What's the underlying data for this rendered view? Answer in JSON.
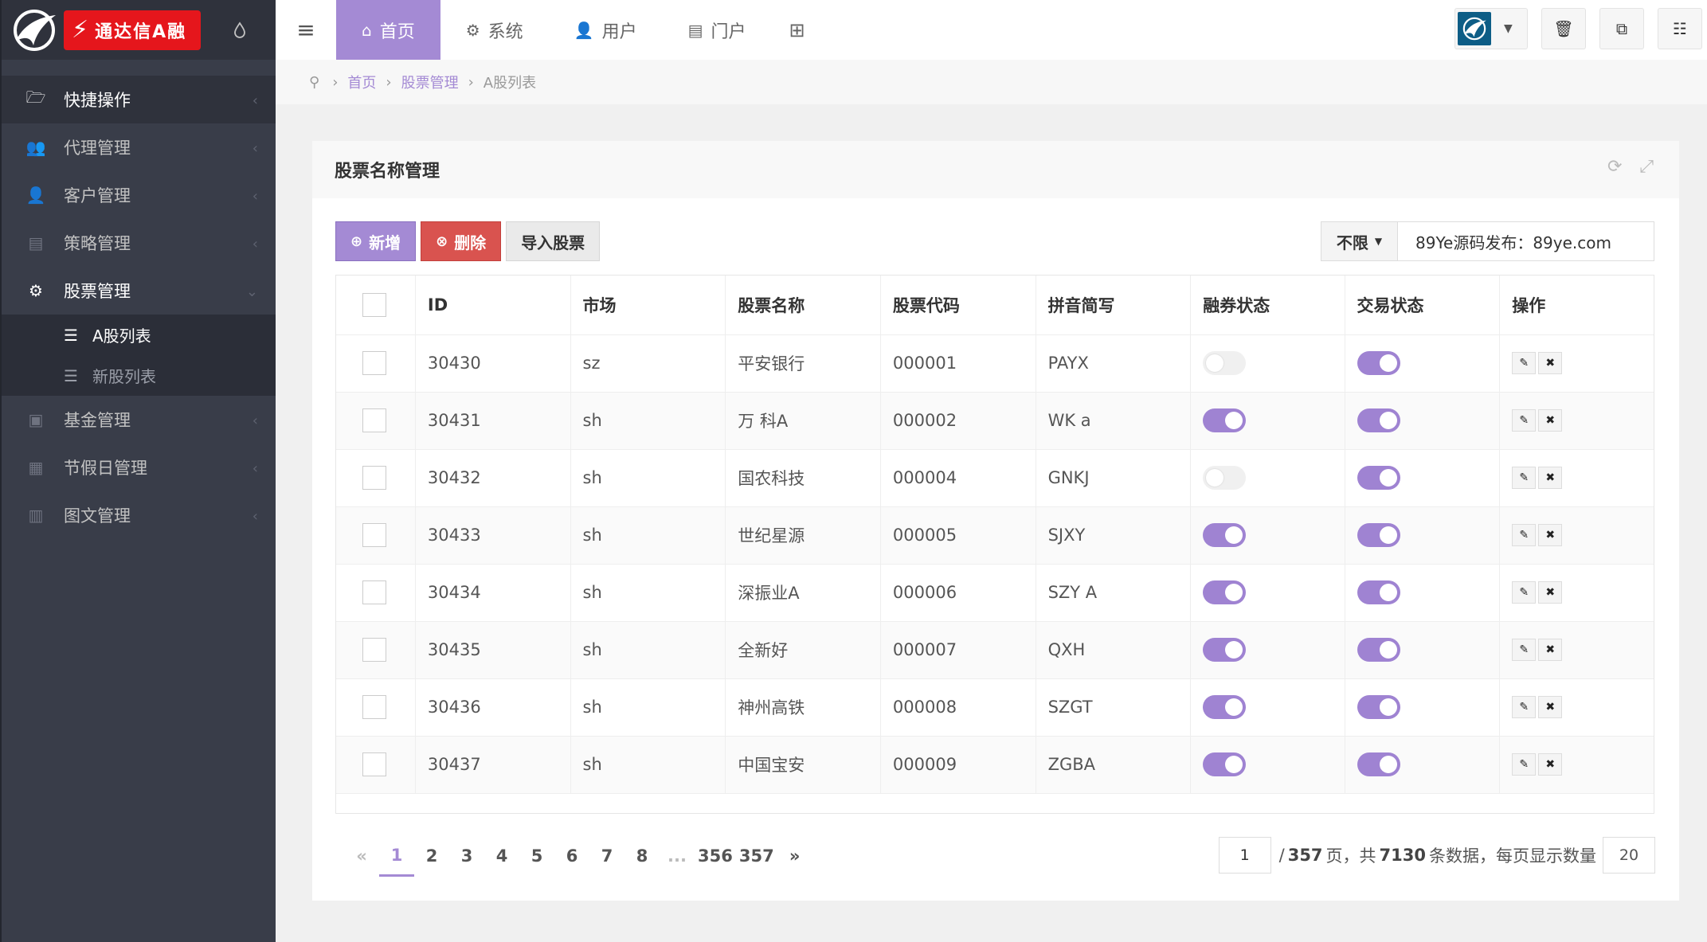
{
  "brand": {
    "logo_text": "通达信A融",
    "logo_mark": "⚡"
  },
  "sidebar": {
    "items": [
      {
        "label": "快捷操作",
        "icon": "folder-open-icon",
        "glyph": "🗁"
      },
      {
        "label": "代理管理",
        "icon": "users-icon",
        "glyph": "👥"
      },
      {
        "label": "客户管理",
        "icon": "user-icon",
        "glyph": "👤"
      },
      {
        "label": "策略管理",
        "icon": "list-alt-icon",
        "glyph": "▤"
      },
      {
        "label": "股票管理",
        "icon": "cogs-icon",
        "glyph": "⚙"
      },
      {
        "label": "基金管理",
        "icon": "money-icon",
        "glyph": "▣"
      },
      {
        "label": "节假日管理",
        "icon": "calendar-icon",
        "glyph": "▦"
      },
      {
        "label": "图文管理",
        "icon": "book-icon",
        "glyph": "▥"
      }
    ],
    "submenu": [
      {
        "label": "A股列表"
      },
      {
        "label": "新股列表"
      }
    ]
  },
  "topbar": {
    "tabs": [
      {
        "label": "首页",
        "glyph": "⌂"
      },
      {
        "label": "系统",
        "glyph": "⚙"
      },
      {
        "label": "用户",
        "glyph": "👤"
      },
      {
        "label": "门户",
        "glyph": "▤"
      }
    ]
  },
  "breadcrumb": {
    "home": "首页",
    "section": "股票管理",
    "current": "A股列表"
  },
  "panel": {
    "title": "股票名称管理"
  },
  "toolbar": {
    "add_label": "新增",
    "delete_label": "删除",
    "import_label": "导入股票",
    "filter_label": "不限",
    "search_value": "89Ye源码发布：89ye.com"
  },
  "table": {
    "headers": [
      "ID",
      "市场",
      "股票名称",
      "股票代码",
      "拼音简写",
      "融券状态",
      "交易状态",
      "操作"
    ],
    "rows": [
      {
        "id": "30430",
        "market": "sz",
        "name": "平安银行",
        "code": "000001",
        "pinyin": "PAYX",
        "short_on": false,
        "trade_on": true
      },
      {
        "id": "30431",
        "market": "sh",
        "name": "万 科A",
        "code": "000002",
        "pinyin": "WK a",
        "short_on": true,
        "trade_on": true
      },
      {
        "id": "30432",
        "market": "sh",
        "name": "国农科技",
        "code": "000004",
        "pinyin": "GNKJ",
        "short_on": false,
        "trade_on": true
      },
      {
        "id": "30433",
        "market": "sh",
        "name": "世纪星源",
        "code": "000005",
        "pinyin": "SJXY",
        "short_on": true,
        "trade_on": true
      },
      {
        "id": "30434",
        "market": "sh",
        "name": "深振业A",
        "code": "000006",
        "pinyin": "SZY A",
        "short_on": true,
        "trade_on": true
      },
      {
        "id": "30435",
        "market": "sh",
        "name": "全新好",
        "code": "000007",
        "pinyin": "QXH",
        "short_on": true,
        "trade_on": true
      },
      {
        "id": "30436",
        "market": "sh",
        "name": "神州高铁",
        "code": "000008",
        "pinyin": "SZGT",
        "short_on": true,
        "trade_on": true
      },
      {
        "id": "30437",
        "market": "sh",
        "name": "中国宝安",
        "code": "000009",
        "pinyin": "ZGBA",
        "short_on": true,
        "trade_on": true
      }
    ]
  },
  "pagination": {
    "prev": "«",
    "next": "»",
    "pages": [
      "1",
      "2",
      "3",
      "4",
      "5",
      "6",
      "7",
      "8",
      "...",
      "356",
      "357"
    ],
    "active_page": "1",
    "current_input": "1",
    "total_pages": "357",
    "total_records": "7130",
    "page_size": "20",
    "text_total_prefix": "/",
    "text_pages": "页，共",
    "text_records": "条数据，每页显示数量"
  },
  "colors": {
    "accent": "#a48ad4",
    "danger": "#d9534f",
    "sidebar_bg": "#393d49"
  }
}
